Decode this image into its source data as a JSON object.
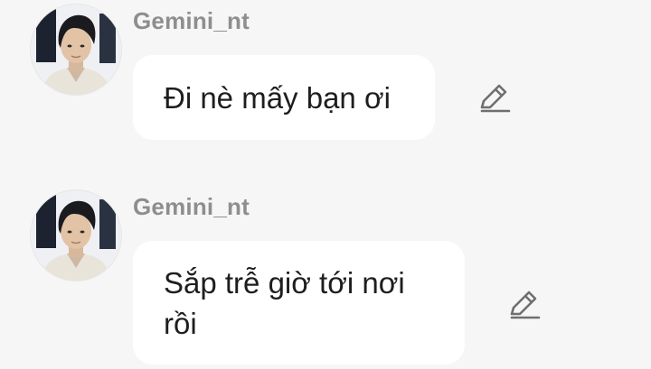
{
  "messages": [
    {
      "sender": "Gemini_nt",
      "avatar_icon": "user-avatar-photo",
      "text": "Đi nè mấy bạn ơi",
      "action_icon": "edit-pencil-icon"
    },
    {
      "sender": "Gemini_nt",
      "avatar_icon": "user-avatar-photo",
      "text": "Sắp trễ giờ tới nơi rồi",
      "action_icon": "edit-pencil-icon"
    }
  ],
  "colors": {
    "background": "#f6f6f6",
    "bubble": "#ffffff",
    "sender_text": "#8e8e8e",
    "message_text": "#1e1e1e",
    "icon": "#6f6f6f"
  }
}
